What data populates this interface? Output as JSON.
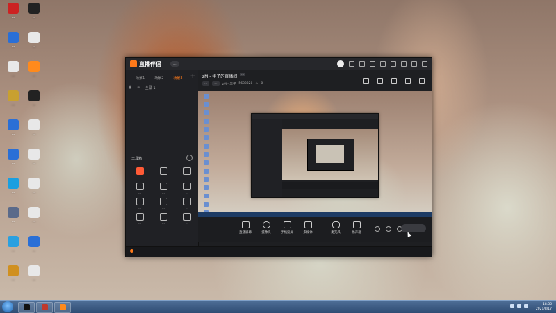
{
  "desktop": {
    "icons": [
      {
        "label": "...",
        "color": "#cc2222",
        "glyph": "●"
      },
      {
        "label": "...",
        "color": "#222222",
        "glyph": "●"
      },
      {
        "label": "...",
        "color": "#2a6fd6",
        "glyph": "■"
      },
      {
        "label": "...",
        "color": "#e8e8e8",
        "glyph": "■"
      },
      {
        "label": "...",
        "color": "#e8e8e8",
        "glyph": "■"
      },
      {
        "label": "...",
        "color": "#ff8a1c",
        "glyph": "■"
      },
      {
        "label": "...",
        "color": "#c8a030",
        "glyph": "■"
      },
      {
        "label": "...",
        "color": "#222222",
        "glyph": "●"
      },
      {
        "label": "...",
        "color": "#2a6fd6",
        "glyph": "■"
      },
      {
        "label": "...",
        "color": "#e8e8e8",
        "glyph": "■"
      },
      {
        "label": "...",
        "color": "#2a6fd6",
        "glyph": "■"
      },
      {
        "label": "...",
        "color": "#e8e8e8",
        "glyph": "■"
      },
      {
        "label": "...",
        "color": "#1a9fe0",
        "glyph": "●"
      },
      {
        "label": "...",
        "color": "#e8e8e8",
        "glyph": "■"
      },
      {
        "label": "...",
        "color": "#5a6a8a",
        "glyph": "■"
      },
      {
        "label": "...",
        "color": "#e8e8e8",
        "glyph": "■"
      },
      {
        "label": "...",
        "color": "#2aa0e0",
        "glyph": "●"
      },
      {
        "label": "...",
        "color": "#2a6fd6",
        "glyph": "■"
      },
      {
        "label": "...",
        "color": "#d09020",
        "glyph": "■"
      },
      {
        "label": "...",
        "color": "#e8e8e8",
        "glyph": "■"
      }
    ]
  },
  "app": {
    "name": "直播伴侣",
    "badge": "...",
    "scene_tabs": [
      "场景1",
      "场景2",
      "场景3"
    ],
    "scene_item": "全景 1",
    "tools_title": "工具箱",
    "tools": [
      {
        "label": "...",
        "hot": true
      },
      {
        "label": "...",
        "hot": false
      },
      {
        "label": "...",
        "hot": false
      },
      {
        "label": "...",
        "hot": false
      },
      {
        "label": "...",
        "hot": false
      },
      {
        "label": "...",
        "hot": false
      },
      {
        "label": "...",
        "hot": false
      },
      {
        "label": "...",
        "hot": false
      },
      {
        "label": "...",
        "hot": false
      },
      {
        "label": "...",
        "hot": false
      },
      {
        "label": "...",
        "hot": false
      },
      {
        "label": "...",
        "hot": false
      }
    ],
    "room_title": "zM - 华子的直播间",
    "room_tag": "...",
    "room_sub": [
      "...",
      "...",
      "zM - 华子",
      "5688828",
      "0"
    ],
    "toolbar": [
      "直播屏幕",
      "摄像头",
      "手机投屏",
      "多媒体",
      "麦克风",
      "扬声器"
    ],
    "live_button": "...",
    "status_text": "...",
    "status_right": [
      "...",
      "...",
      "..."
    ],
    "accent_color": "#ff7a1a"
  },
  "taskbar": {
    "apps": [
      {
        "color": "#111111"
      },
      {
        "color": "#c0392b"
      },
      {
        "color": "#ff8a1c"
      }
    ],
    "time": "18:55",
    "date": "2021/8/17"
  }
}
